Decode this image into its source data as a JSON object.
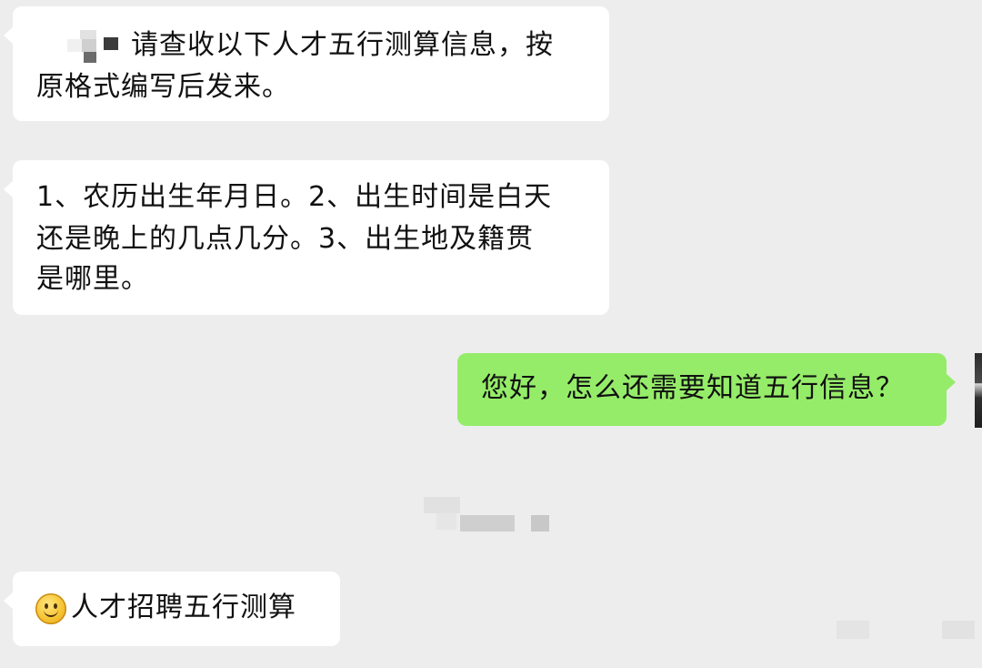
{
  "messages": [
    {
      "sender": "other",
      "text_line1": "请查收以下人才五行测算信息，按",
      "text_line2": "原格式编写后发来。"
    },
    {
      "sender": "other",
      "text_line1": "1、农历出生年月日。2、出生时间是白天",
      "text_line2": "还是晚上的几点几分。3、出生地及籍贯",
      "text_line3": "是哪里。"
    },
    {
      "sender": "self",
      "text_line1": "您好，怎么还需要知道五行信息？"
    },
    {
      "sender": "other",
      "emoji": "smile-emoji",
      "text_line1": "人才招聘五行测算"
    }
  ],
  "colors": {
    "background": "#ededed",
    "incoming_bubble": "#ffffff",
    "outgoing_bubble": "#95ec69"
  }
}
